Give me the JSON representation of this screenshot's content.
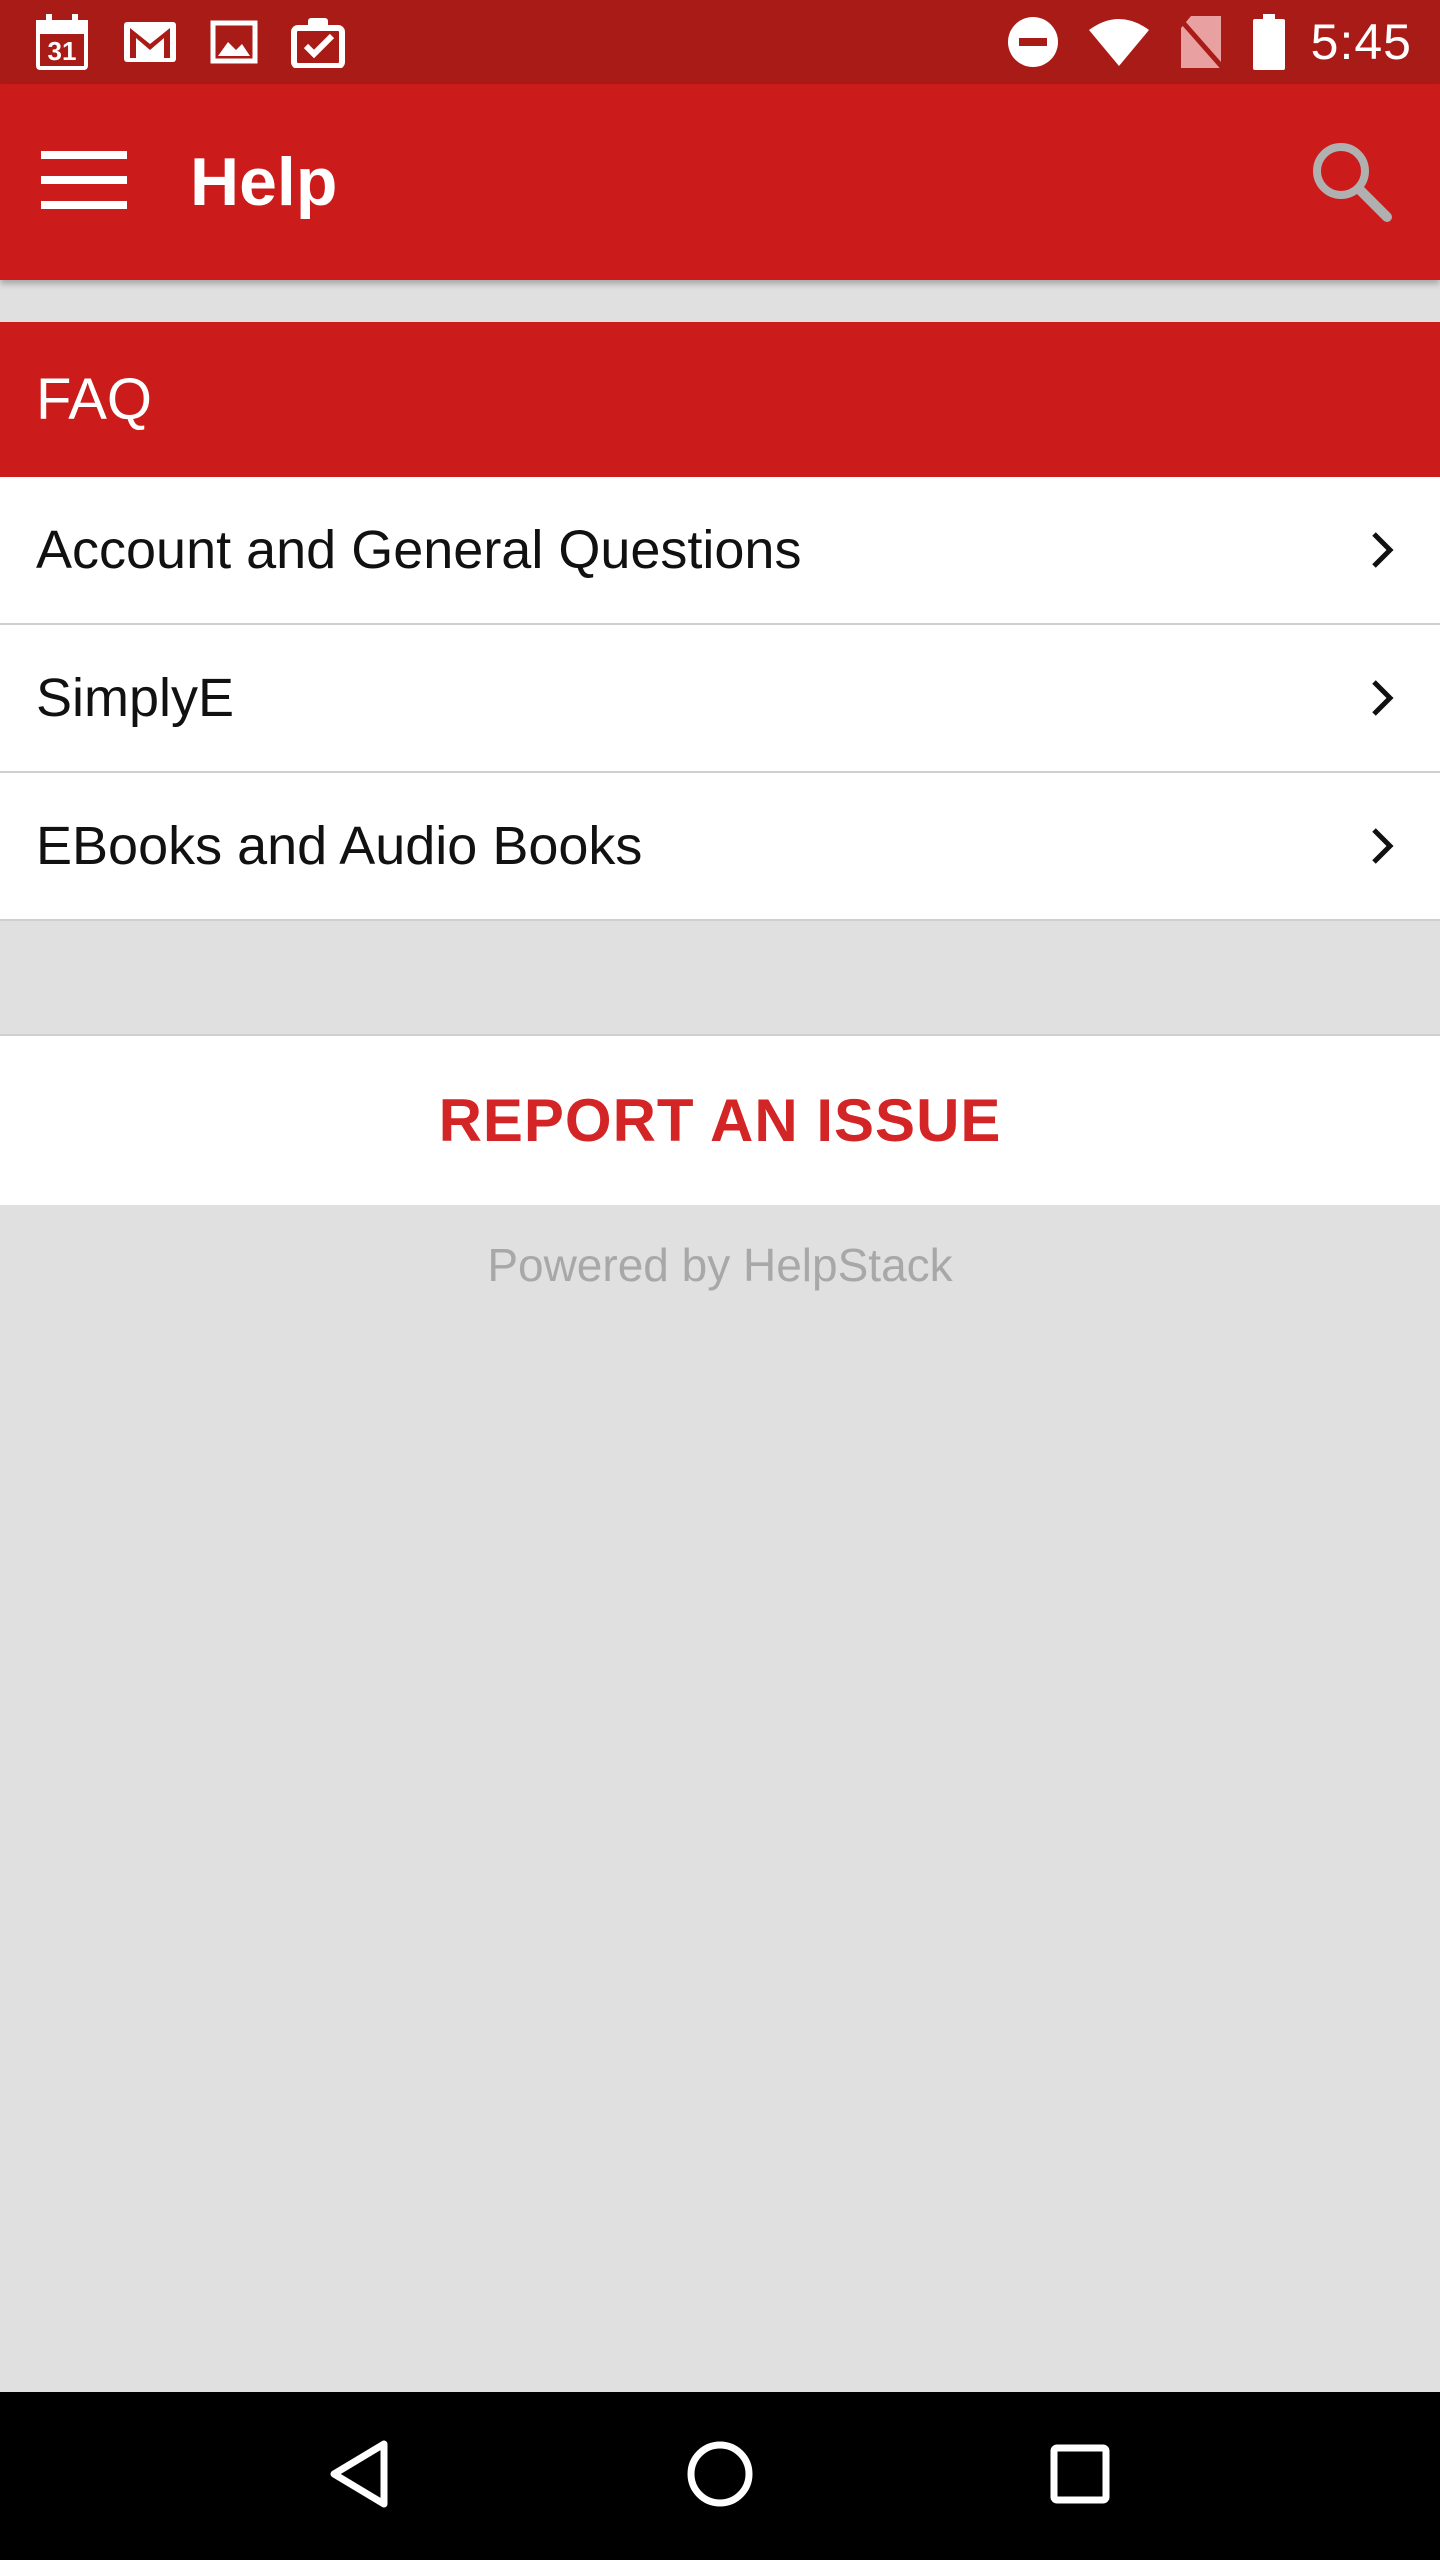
{
  "status_bar": {
    "calendar_day": "31",
    "time": "5:45",
    "icons": [
      "calendar-icon",
      "gmail-icon",
      "image-icon",
      "clipboard-check-icon",
      "do-not-disturb-icon",
      "wifi-icon",
      "no-sim-icon",
      "battery-icon"
    ]
  },
  "app_bar": {
    "title": "Help",
    "menu_icon": "hamburger-menu-icon",
    "search_icon": "search-icon"
  },
  "faq": {
    "header": "FAQ",
    "items": [
      {
        "label": "Account and General Questions"
      },
      {
        "label": "SimplyE"
      },
      {
        "label": "EBooks and Audio Books"
      }
    ]
  },
  "report": {
    "label": "REPORT AN ISSUE"
  },
  "footer": {
    "powered_by": "Powered by HelpStack"
  },
  "nav_bar": {
    "icons": [
      "back-icon",
      "home-icon",
      "recents-icon"
    ]
  },
  "colors": {
    "status_bar": "#a91b17",
    "primary": "#cb1b1a",
    "accent_text": "#d32525",
    "background": "#e0e0e0"
  }
}
